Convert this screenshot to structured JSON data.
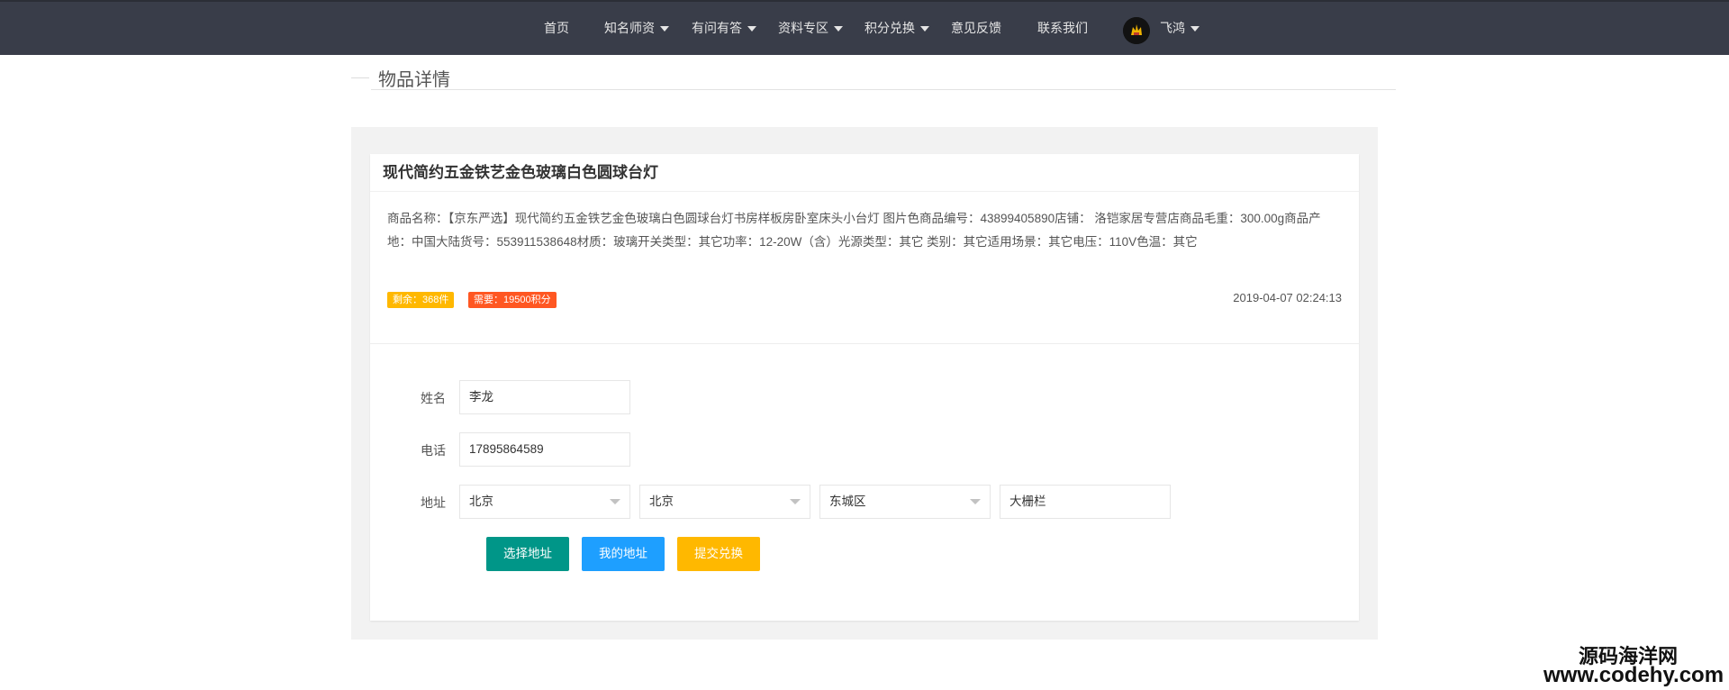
{
  "nav": {
    "items": [
      {
        "label": "首页",
        "has_dropdown": false
      },
      {
        "label": "知名师资",
        "has_dropdown": true
      },
      {
        "label": "有问有答",
        "has_dropdown": true
      },
      {
        "label": "资料专区",
        "has_dropdown": true
      },
      {
        "label": "积分兑换",
        "has_dropdown": true
      },
      {
        "label": "意见反馈",
        "has_dropdown": false
      },
      {
        "label": "联系我们",
        "has_dropdown": false
      }
    ],
    "user": {
      "name": "飞鸿",
      "avatar_icon": "user-avatar-icon"
    }
  },
  "section": {
    "title": "物品详情"
  },
  "product": {
    "title": "现代简约五金铁艺金色玻璃白色圆球台灯",
    "description": "商品名称：【京东严选】现代简约五金铁艺金色玻璃白色圆球台灯书房样板房卧室床头小台灯 图片色商品编号：43899405890店铺： 洛铠家居专营店商品毛重：300.00g商品产地：中国大陆货号：553911538648材质：玻璃开关类型：其它功率：12-20W（含）光源类型：其它   类别：其它适用场景：其它电压：110V色温：其它",
    "stock_label": "剩余：368件",
    "points_label": "需要：19500积分",
    "date": "2019-04-07 02:24:13"
  },
  "form": {
    "name_label": "姓名",
    "name_value": "李龙",
    "phone_label": "电话",
    "phone_value": "17895864589",
    "address_label": "地址",
    "province": "北京",
    "city": "北京",
    "district": "东城区",
    "street": "大栅栏"
  },
  "buttons": {
    "choose_address": "选择地址",
    "my_address": "我的地址",
    "submit": "提交兑换"
  },
  "colors": {
    "nav_bg": "#393d49",
    "teal": "#009688",
    "blue": "#1e9fff",
    "yellow": "#ffb800",
    "orange": "#ff5722"
  },
  "watermark": {
    "line1": "源码海洋网",
    "line2": "www.codehy.com"
  }
}
